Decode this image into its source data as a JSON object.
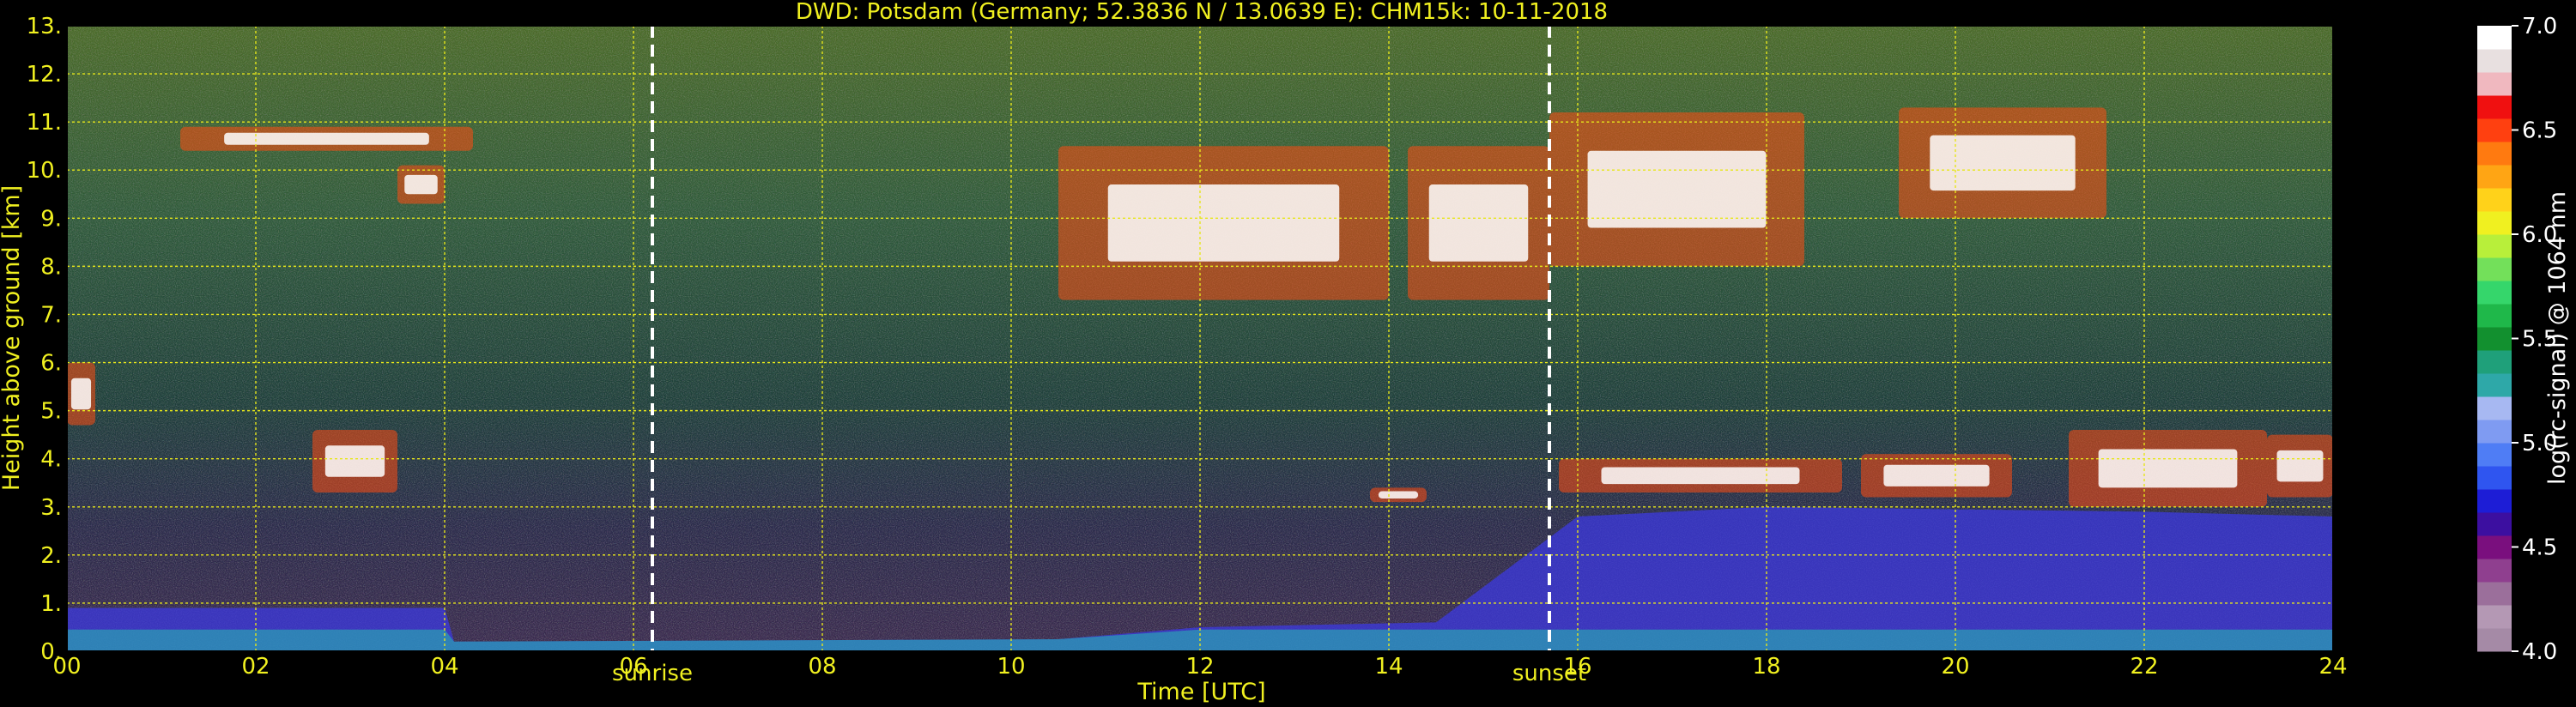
{
  "chart_data": {
    "type": "heatmap",
    "title": "DWD: Potsdam (Germany; 52.3836 N / 13.0639 E):    CHM15k: 10-11-2018",
    "xlabel": "Time [UTC]",
    "ylabel": "Height above ground [km]",
    "xlim": [
      0,
      24
    ],
    "ylim": [
      0,
      13
    ],
    "x_ticks": [
      "00",
      "02",
      "04",
      "06",
      "08",
      "10",
      "12",
      "14",
      "16",
      "18",
      "20",
      "22",
      "24"
    ],
    "y_ticks": [
      "0.",
      "1.",
      "2.",
      "3.",
      "4.",
      "5.",
      "6.",
      "7.",
      "8.",
      "9.",
      "10.",
      "11.",
      "12.",
      "13."
    ],
    "grid": true,
    "colorbar": {
      "label": "log(rc-signal) @ 1064 nm",
      "range": [
        4.0,
        7.0
      ],
      "ticks": [
        "4.0",
        "4.5",
        "5.0",
        "5.5",
        "6.0",
        "6.5",
        "7.0"
      ],
      "colors": [
        "#a58aa6",
        "#b498b4",
        "#9b6f9b",
        "#8f3f8f",
        "#7a0f7e",
        "#3c0fa0",
        "#1d1dd6",
        "#2f55f0",
        "#4f7df5",
        "#7f9bf2",
        "#a7b8f2",
        "#2ea8a8",
        "#1fa07a",
        "#12902f",
        "#1fb84a",
        "#35d66b",
        "#73e05a",
        "#b8ef3a",
        "#f0f020",
        "#ffd21a",
        "#ffa514",
        "#ff7a10",
        "#ff4010",
        "#f01010",
        "#f0b8bf",
        "#e8e0e0",
        "#ffffff"
      ]
    },
    "annotations": {
      "sunrise": {
        "x": 6.2,
        "label": "sunrise"
      },
      "sunset": {
        "x": 15.7,
        "label": "sunset"
      }
    },
    "features": {
      "boundary_layer_top_km": [
        {
          "t": 0.0,
          "h": 0.9
        },
        {
          "t": 4.0,
          "h": 0.9
        },
        {
          "t": 4.1,
          "h": 0.2
        },
        {
          "t": 10.5,
          "h": 0.25
        },
        {
          "t": 12.0,
          "h": 0.5
        },
        {
          "t": 14.5,
          "h": 0.6
        },
        {
          "t": 16.0,
          "h": 2.8
        },
        {
          "t": 18.0,
          "h": 3.0
        },
        {
          "t": 22.0,
          "h": 2.9
        },
        {
          "t": 24.0,
          "h": 2.8
        }
      ],
      "cloud_layers": [
        {
          "t_start": 1.2,
          "t_end": 4.3,
          "h_base": 10.4,
          "h_top": 10.9
        },
        {
          "t_start": 3.5,
          "t_end": 4.0,
          "h_base": 9.3,
          "h_top": 10.1
        },
        {
          "t_start": 2.6,
          "t_end": 3.5,
          "h_base": 3.3,
          "h_top": 4.6
        },
        {
          "t_start": 0.0,
          "t_end": 0.3,
          "h_base": 4.7,
          "h_top": 6.0
        },
        {
          "t_start": 10.5,
          "t_end": 14.0,
          "h_base": 7.3,
          "h_top": 10.5
        },
        {
          "t_start": 14.2,
          "t_end": 15.7,
          "h_base": 7.3,
          "h_top": 10.5
        },
        {
          "t_start": 15.7,
          "t_end": 18.4,
          "h_base": 8.0,
          "h_top": 11.2
        },
        {
          "t_start": 19.4,
          "t_end": 21.6,
          "h_base": 9.0,
          "h_top": 11.3
        },
        {
          "t_start": 13.8,
          "t_end": 14.4,
          "h_base": 3.1,
          "h_top": 3.4
        },
        {
          "t_start": 15.8,
          "t_end": 18.8,
          "h_base": 3.3,
          "h_top": 4.0
        },
        {
          "t_start": 19.0,
          "t_end": 20.6,
          "h_base": 3.2,
          "h_top": 4.1
        },
        {
          "t_start": 21.2,
          "t_end": 23.3,
          "h_base": 3.0,
          "h_top": 4.6
        },
        {
          "t_start": 23.3,
          "t_end": 24.0,
          "h_base": 3.2,
          "h_top": 4.5
        }
      ]
    }
  }
}
